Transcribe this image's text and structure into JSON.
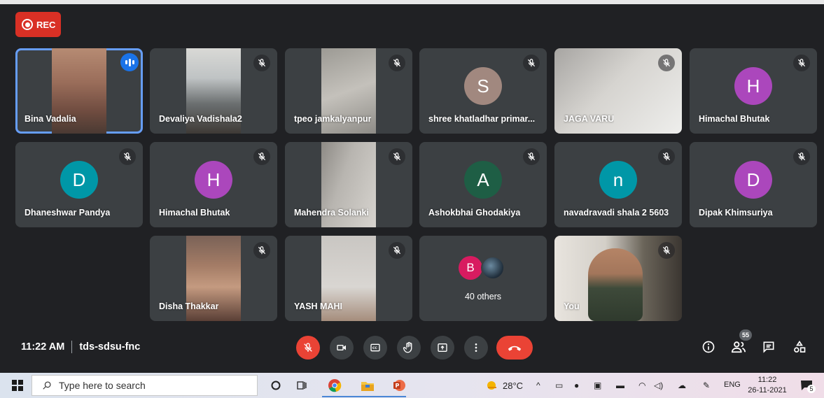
{
  "meeting": {
    "rec_label": "REC",
    "time": "11:22 AM",
    "code": "tds-sdsu-fnc",
    "people_count": "55"
  },
  "tiles": [
    {
      "name": "Bina Vadalia",
      "type": "video",
      "active": true
    },
    {
      "name": "Devaliya Vadishala2",
      "type": "video"
    },
    {
      "name": "tpeo jamkalyanpur",
      "type": "video"
    },
    {
      "name": "shree khatladhar primar...",
      "type": "avatar",
      "initial": "S",
      "color": "#a1887f"
    },
    {
      "name": "JAGA VARU",
      "type": "video"
    },
    {
      "name": "Himachal Bhutak",
      "type": "avatar",
      "initial": "H",
      "color": "#ab47bc"
    },
    {
      "name": "Dhaneshwar Pandya",
      "type": "avatar",
      "initial": "D",
      "color": "#0097a7"
    },
    {
      "name": "Himachal Bhutak",
      "type": "avatar",
      "initial": "H",
      "color": "#ab47bc"
    },
    {
      "name": "Mahendra Solanki",
      "type": "video"
    },
    {
      "name": "Ashokbhai Ghodakiya",
      "type": "avatar",
      "initial": "A",
      "color": "#1e5e45"
    },
    {
      "name": "navadravadi shala 2 5603",
      "type": "avatar",
      "initial": "n",
      "color": "#0097a7"
    },
    {
      "name": "Dipak Khimsuriya",
      "type": "avatar",
      "initial": "D",
      "color": "#ab47bc"
    },
    {
      "name": "Disha Thakkar",
      "type": "video"
    },
    {
      "name": "YASH MAHI",
      "type": "video"
    },
    {
      "name": "40 others",
      "type": "others",
      "initial": "B",
      "color": "#d81b60"
    },
    {
      "name": "You",
      "type": "video"
    }
  ],
  "controls": [
    "mic-off",
    "camera",
    "captions",
    "raise-hand",
    "present",
    "more",
    "leave-call"
  ],
  "right_controls": [
    "meeting-details",
    "people",
    "chat",
    "activities"
  ],
  "taskbar": {
    "search_placeholder": "Type here to search",
    "temperature": "28°C",
    "language": "ENG",
    "time": "11:22",
    "date": "26-11-2021",
    "notification_count": "5"
  },
  "colors": {
    "background": "#202124",
    "tile": "#3c4043",
    "accent": "#1a73e8",
    "danger": "#ea4335"
  }
}
